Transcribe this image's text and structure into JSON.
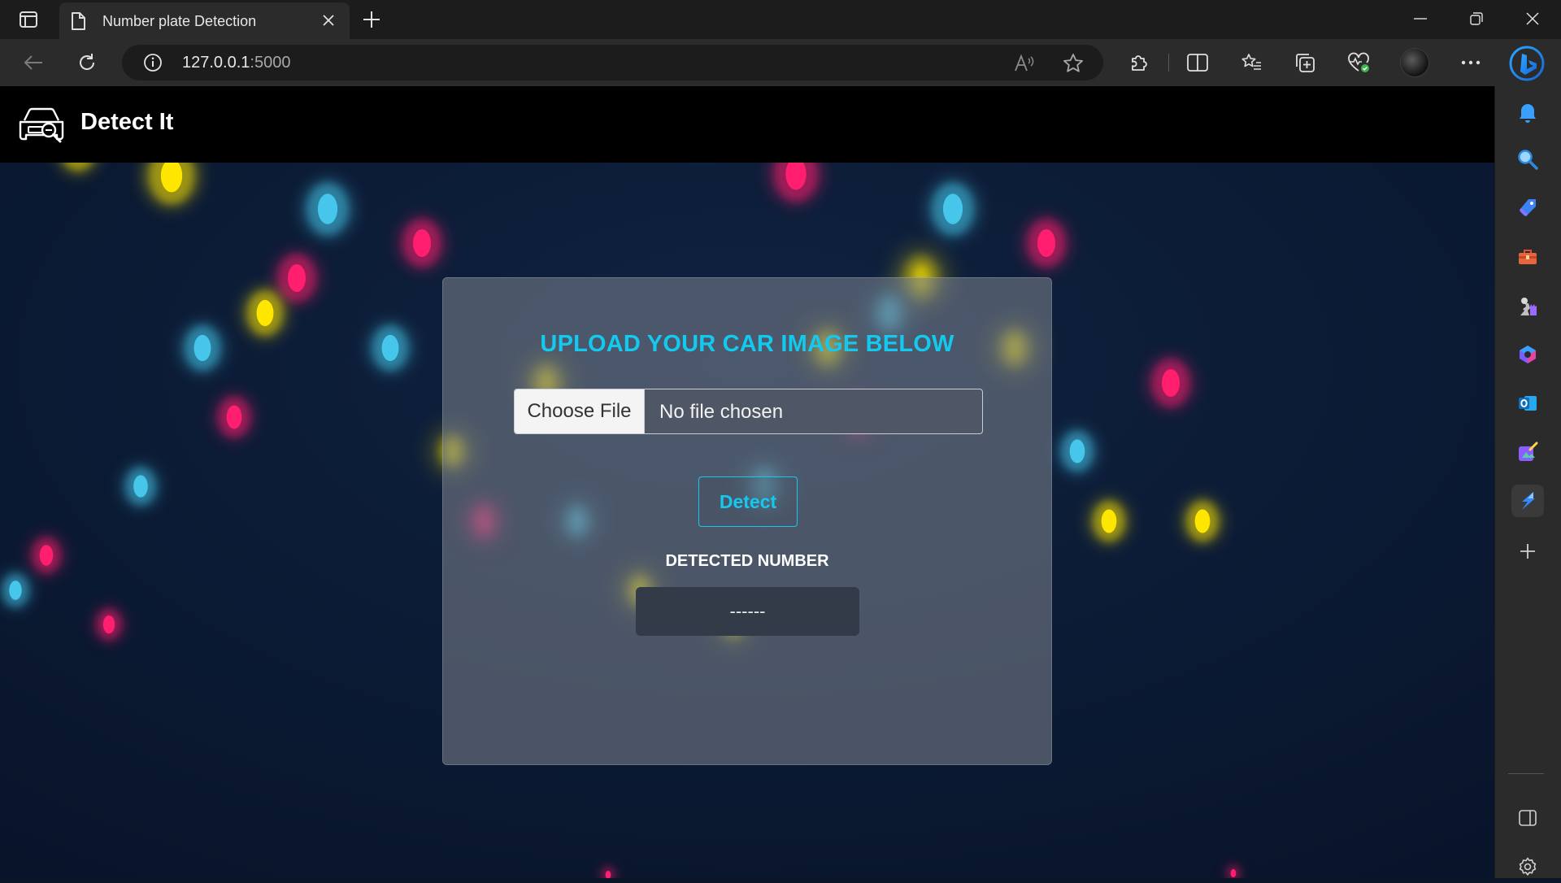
{
  "browser": {
    "tab_title": "Number plate Detection",
    "url_host": "127.0.0.1",
    "url_port": ":5000"
  },
  "site": {
    "title": "Detect It"
  },
  "upload": {
    "heading": "UPLOAD YOUR CAR IMAGE BELOW",
    "choose_file_label": "Choose File",
    "file_status": "No file chosen",
    "detect_label": "Detect",
    "detected_label": "DETECTED NUMBER",
    "detected_value": "------"
  },
  "colors": {
    "accent": "#14c9ee",
    "page_bg": "#0a1628",
    "header_bg": "#000000",
    "bokeh_yellow": "#ffe600",
    "bokeh_pink": "#ff1f6e",
    "bokeh_cyan": "#45c6ea"
  },
  "icons": {
    "sidebar": [
      "bell-icon",
      "search-icon",
      "tag-icon",
      "toolbox-icon",
      "games-icon",
      "copilot-icon",
      "outlook-icon",
      "designer-icon",
      "drop-icon",
      "add-icon",
      "split-panel-icon",
      "settings-icon"
    ]
  }
}
